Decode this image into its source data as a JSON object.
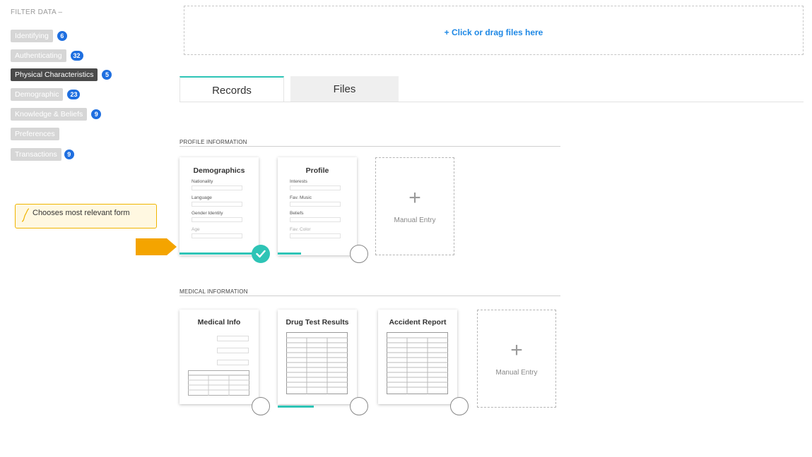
{
  "sidebar": {
    "title": "FILTER DATA",
    "collapse_glyph": "–",
    "filters": [
      {
        "label": "Identifying",
        "count": "6",
        "active": false
      },
      {
        "label": "Authenticating",
        "count": "32",
        "active": false
      },
      {
        "label": "Physical Characteristics",
        "count": "5",
        "active": true
      },
      {
        "label": "Demographic",
        "count": "23",
        "active": false
      },
      {
        "label": "Knowledge & Beliefs",
        "count": "9",
        "active": false
      },
      {
        "label": "Preferences",
        "count": "",
        "active": false
      },
      {
        "label": "Transactions",
        "count": "9",
        "active": false
      }
    ]
  },
  "tooltip": {
    "text": "Chooses most relevant form",
    "icon": "curve-icon"
  },
  "dropzone": {
    "text": "+ Click or drag files here"
  },
  "tabs": [
    {
      "label": "Records",
      "active": true
    },
    {
      "label": "Files",
      "active": false
    }
  ],
  "profile_section": {
    "title": "PROFILE INFORMATION",
    "cards": [
      {
        "title": "Demographics",
        "fields": [
          "Nationality",
          "Language",
          "Gender Identity",
          "Age"
        ],
        "status": "selected",
        "progress": 1.0
      },
      {
        "title": "Profile",
        "fields": [
          "Interests",
          "Fav. Music",
          "Beliefs",
          "Fav. Color"
        ],
        "status": "unselected",
        "progress": 0.3
      }
    ],
    "manual_entry": {
      "plus": "+",
      "label": "Manual Entry"
    }
  },
  "medical_section": {
    "title": "MEDICAL INFORMATION",
    "cards": [
      {
        "title": "Medical Info",
        "status": "unselected",
        "progress": 0
      },
      {
        "title": "Drug Test Results",
        "status": "unselected",
        "progress": 0.4
      },
      {
        "title": "Accident Report",
        "status": "unselected",
        "progress": 0
      }
    ],
    "manual_entry": {
      "plus": "+",
      "label": "Manual Entry"
    }
  },
  "colors": {
    "accent": "#2ec4b6",
    "link": "#1e88e5",
    "badge": "#1f6fe0",
    "tooltip_border": "#f0b400",
    "arrow": "#f4a400"
  }
}
